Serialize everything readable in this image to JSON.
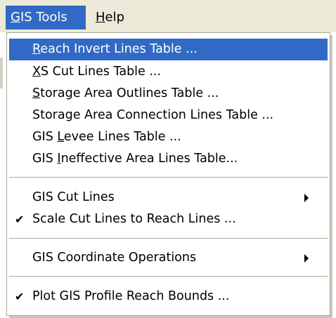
{
  "menubar": {
    "items": [
      {
        "label_prefix": "",
        "accel": "G",
        "label_rest": "IS Tools",
        "state": "open"
      },
      {
        "label_prefix": "",
        "accel": "H",
        "label_rest": "elp",
        "state": "normal"
      }
    ]
  },
  "menu": {
    "items": [
      {
        "prefix": "",
        "accel": "R",
        "rest": "each Invert Lines Table ...",
        "checked": false,
        "submenu": false,
        "highlighted": true
      },
      {
        "prefix": "",
        "accel": "X",
        "rest": "S Cut Lines Table ...",
        "checked": false,
        "submenu": false,
        "highlighted": false
      },
      {
        "prefix": "",
        "accel": "S",
        "rest": "torage Area Outlines Table ...",
        "checked": false,
        "submenu": false,
        "highlighted": false
      },
      {
        "prefix": "Storage Area Connection Lines Table ...",
        "accel": "",
        "rest": "",
        "checked": false,
        "submenu": false,
        "highlighted": false
      },
      {
        "prefix": "GIS ",
        "accel": "L",
        "rest": "evee Lines Table ...",
        "checked": false,
        "submenu": false,
        "highlighted": false
      },
      {
        "prefix": "GIS ",
        "accel": "I",
        "rest": "neffective Area Lines Table...",
        "checked": false,
        "submenu": false,
        "highlighted": false
      },
      {
        "prefix": "GIS Cut Lines",
        "accel": "",
        "rest": "",
        "checked": false,
        "submenu": true,
        "highlighted": false
      },
      {
        "prefix": "Scale Cut Lines to Reach Lines ...",
        "accel": "",
        "rest": "",
        "checked": true,
        "submenu": false,
        "highlighted": false
      },
      {
        "prefix": "GIS Coordinate Operations",
        "accel": "",
        "rest": "",
        "checked": false,
        "submenu": true,
        "highlighted": false
      },
      {
        "prefix": "Plot GIS Profile Reach Bounds ...",
        "accel": "",
        "rest": "",
        "checked": true,
        "submenu": false,
        "highlighted": false
      }
    ]
  },
  "icons": {
    "check": "checkmark-icon",
    "submenu": "submenu-arrow-icon"
  },
  "colors": {
    "highlight": "#316ac5",
    "menubar_bg": "#ece9d8",
    "separator": "#aca899"
  }
}
